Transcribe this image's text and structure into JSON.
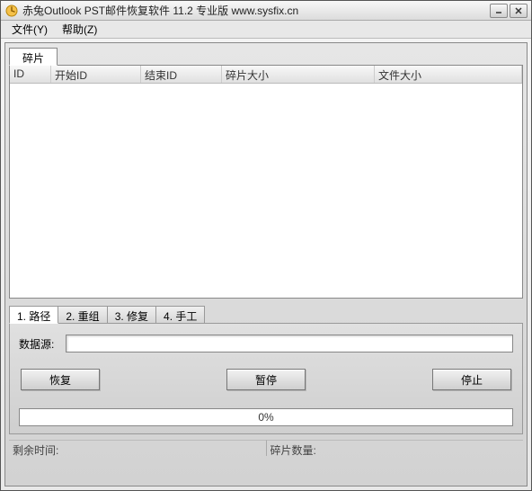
{
  "window": {
    "title": "赤兔Outlook PST邮件恢复软件 11.2 专业版 www.sysfix.cn"
  },
  "menu": {
    "file": "文件(Y)",
    "help": "帮助(Z)"
  },
  "upper_tab": {
    "fragments": "碎片"
  },
  "table": {
    "columns": [
      "ID",
      "开始ID",
      "结束ID",
      "碎片大小",
      "文件大小"
    ],
    "rows": []
  },
  "lower_tabs": {
    "items": [
      {
        "label": "1. 路径"
      },
      {
        "label": "2. 重组"
      },
      {
        "label": "3. 修复"
      },
      {
        "label": "4. 手工"
      }
    ]
  },
  "form": {
    "source_label": "数据源:",
    "source_value": ""
  },
  "buttons": {
    "recover": "恢复",
    "pause": "暂停",
    "stop": "停止"
  },
  "progress": {
    "text": "0%"
  },
  "status": {
    "remaining": "剩余时间:",
    "frag_count": "碎片数量:"
  }
}
